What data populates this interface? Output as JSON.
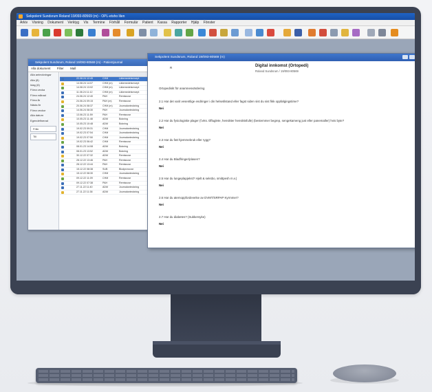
{
  "app": {
    "title": "Sekpolent Sundsrum Roland 19/093-80569 (m) - OPL-etsho lilen",
    "menu": [
      "Arkiv",
      "Visning",
      "Dokument",
      "Verktyg",
      "Vis",
      "Termine",
      "Förhåll",
      "Formulär",
      "Patient",
      "Kassa",
      "Rapporter",
      "Hjälp",
      "Fönster"
    ]
  },
  "back_window": {
    "title": "Sekpolent Sundsrum, Roland 19/093-80569 (m) - Patientjournal",
    "tabs": [
      "Alla dokument",
      "Filter",
      "Mall"
    ],
    "left_panel": [
      "Alla anteckningar",
      "Alla (8)",
      "Idag (6)",
      "Förra vecka",
      "Förra månad",
      "Förra år",
      "Nästa år",
      "Förra veckor",
      "Alla datum",
      "Egendefinerad",
      "Från",
      "Till"
    ],
    "rows": [
      {
        "date": "22.08.24 12:45",
        "sign": "CHM",
        "type": "Läkemedelsrecept",
        "selected": true
      },
      {
        "date": "14.08.24 14:07",
        "sign": "CHM (m)",
        "type": "Läkemedelsrecept",
        "selected": false
      },
      {
        "date": "14.08.24 13:02",
        "sign": "CHM (m)",
        "type": "Läkemedelsrecept",
        "selected": false
      },
      {
        "date": "11.08.24 11:12",
        "sign": "CHM (m)",
        "type": "Läkemedelsrecept",
        "selected": false
      },
      {
        "date": "24.06.24 12:40",
        "sign": "PAH",
        "type": "Remissvar",
        "selected": false
      },
      {
        "date": "24.06.24 09:15",
        "sign": "PAH (m)",
        "type": "Remissvar",
        "selected": false
      },
      {
        "date": "20.06.24 08:37",
        "sign": "CHM (m)",
        "type": "Journalanteckning",
        "selected": false
      },
      {
        "date": "14.06.24 08:30",
        "sign": "PAH",
        "type": "Journalanteckning",
        "selected": false
      },
      {
        "date": "13.06.23 11:59",
        "sign": "PAH",
        "type": "Remissvar",
        "selected": false
      },
      {
        "date": "10.05.23 11:48",
        "sign": "ADM",
        "type": "Bokning",
        "selected": false
      },
      {
        "date": "10.05.23 10:48",
        "sign": "ADM",
        "type": "Bokning",
        "selected": false
      },
      {
        "date": "19.02.23 09:31",
        "sign": "CHM",
        "type": "Journalanteckning",
        "selected": false
      },
      {
        "date": "19.02.23 07:54",
        "sign": "CHM",
        "type": "Journalanteckning",
        "selected": false
      },
      {
        "date": "19.02.23 07:50",
        "sign": "CHM",
        "type": "Journalanteckning",
        "selected": false
      },
      {
        "date": "19.02.23 06:42",
        "sign": "CHM",
        "type": "Remissvar",
        "selected": false
      },
      {
        "date": "08.01.23 14:08",
        "sign": "ADM",
        "type": "Bokning",
        "selected": false
      },
      {
        "date": "08.01.23 13:52",
        "sign": "ADM",
        "type": "Bokning",
        "selected": false
      },
      {
        "date": "30.12.22 07:32",
        "sign": "ADM",
        "type": "Remissvar",
        "selected": false
      },
      {
        "date": "28.12.22 13:46",
        "sign": "PAH",
        "type": "Remissvar",
        "selected": false
      },
      {
        "date": "28.12.22 13:44",
        "sign": "PAH",
        "type": "Remissvar",
        "selected": false
      },
      {
        "date": "15.12.22 08:38",
        "sign": "SUB",
        "type": "Blodprovsvar",
        "selected": false
      },
      {
        "date": "15.12.22 08:30",
        "sign": "CHM",
        "type": "Journalanteckning",
        "selected": false
      },
      {
        "date": "09.12.22 11:09",
        "sign": "CHM",
        "type": "Remissvar",
        "selected": false
      },
      {
        "date": "09.12.22 07:38",
        "sign": "PAH",
        "type": "Remissvar",
        "selected": false
      },
      {
        "date": "27.11.22 11:40",
        "sign": "ADM",
        "type": "Journalanteckning",
        "selected": false
      },
      {
        "date": "27.11.22 11:38",
        "sign": "ADM",
        "type": "Journalanteckning",
        "selected": false
      }
    ]
  },
  "doc_window": {
    "title": "Sekpolent Sundsrum, Roland 19/093-80569 (m)",
    "corner_label": "R",
    "doc_title": "Digital innkomst (Ortopedi)",
    "doc_subtitle": "Roland Sundsrum / 19/093-80569",
    "intro": "Ortopediskt för anamnesvärdering",
    "items": [
      {
        "q": "2.1 Har det varit vesentlige endringer i din helsetilstand eller fagst siden sist du sist fikk oppfølgingstime?",
        "a": "Nei"
      },
      {
        "q": "2.2 Har du fysiologiske plager (f.eks. tilfluglete, hensikter hensiktsfulle) (bestemmer begrep, sengekameng just eller panemaller) hvis byte?",
        "a": "Nei"
      },
      {
        "q": "2.3 Har du fatt hjemmebruk eller rygg?",
        "a": "Nei"
      },
      {
        "q": "2.4 Har du Bladfringer/plasen?",
        "a": "Nei"
      },
      {
        "q": "2.5 Har du lungeplapjekst? Hjelt & seksbo, smittpesh m.v.)",
        "a": "Nei"
      },
      {
        "q": "2.6 Har du atemoppfordevelse av DVMT/SRPAP Kyrmmer?",
        "a": "Nei"
      },
      {
        "q": "2.7 Har du diabetes? (Sukkersyke)",
        "a": "Nei"
      }
    ]
  },
  "colors": {
    "titlebar": "#1f63c6",
    "selection": "#3f77c9",
    "monitor": "#3b4252"
  }
}
